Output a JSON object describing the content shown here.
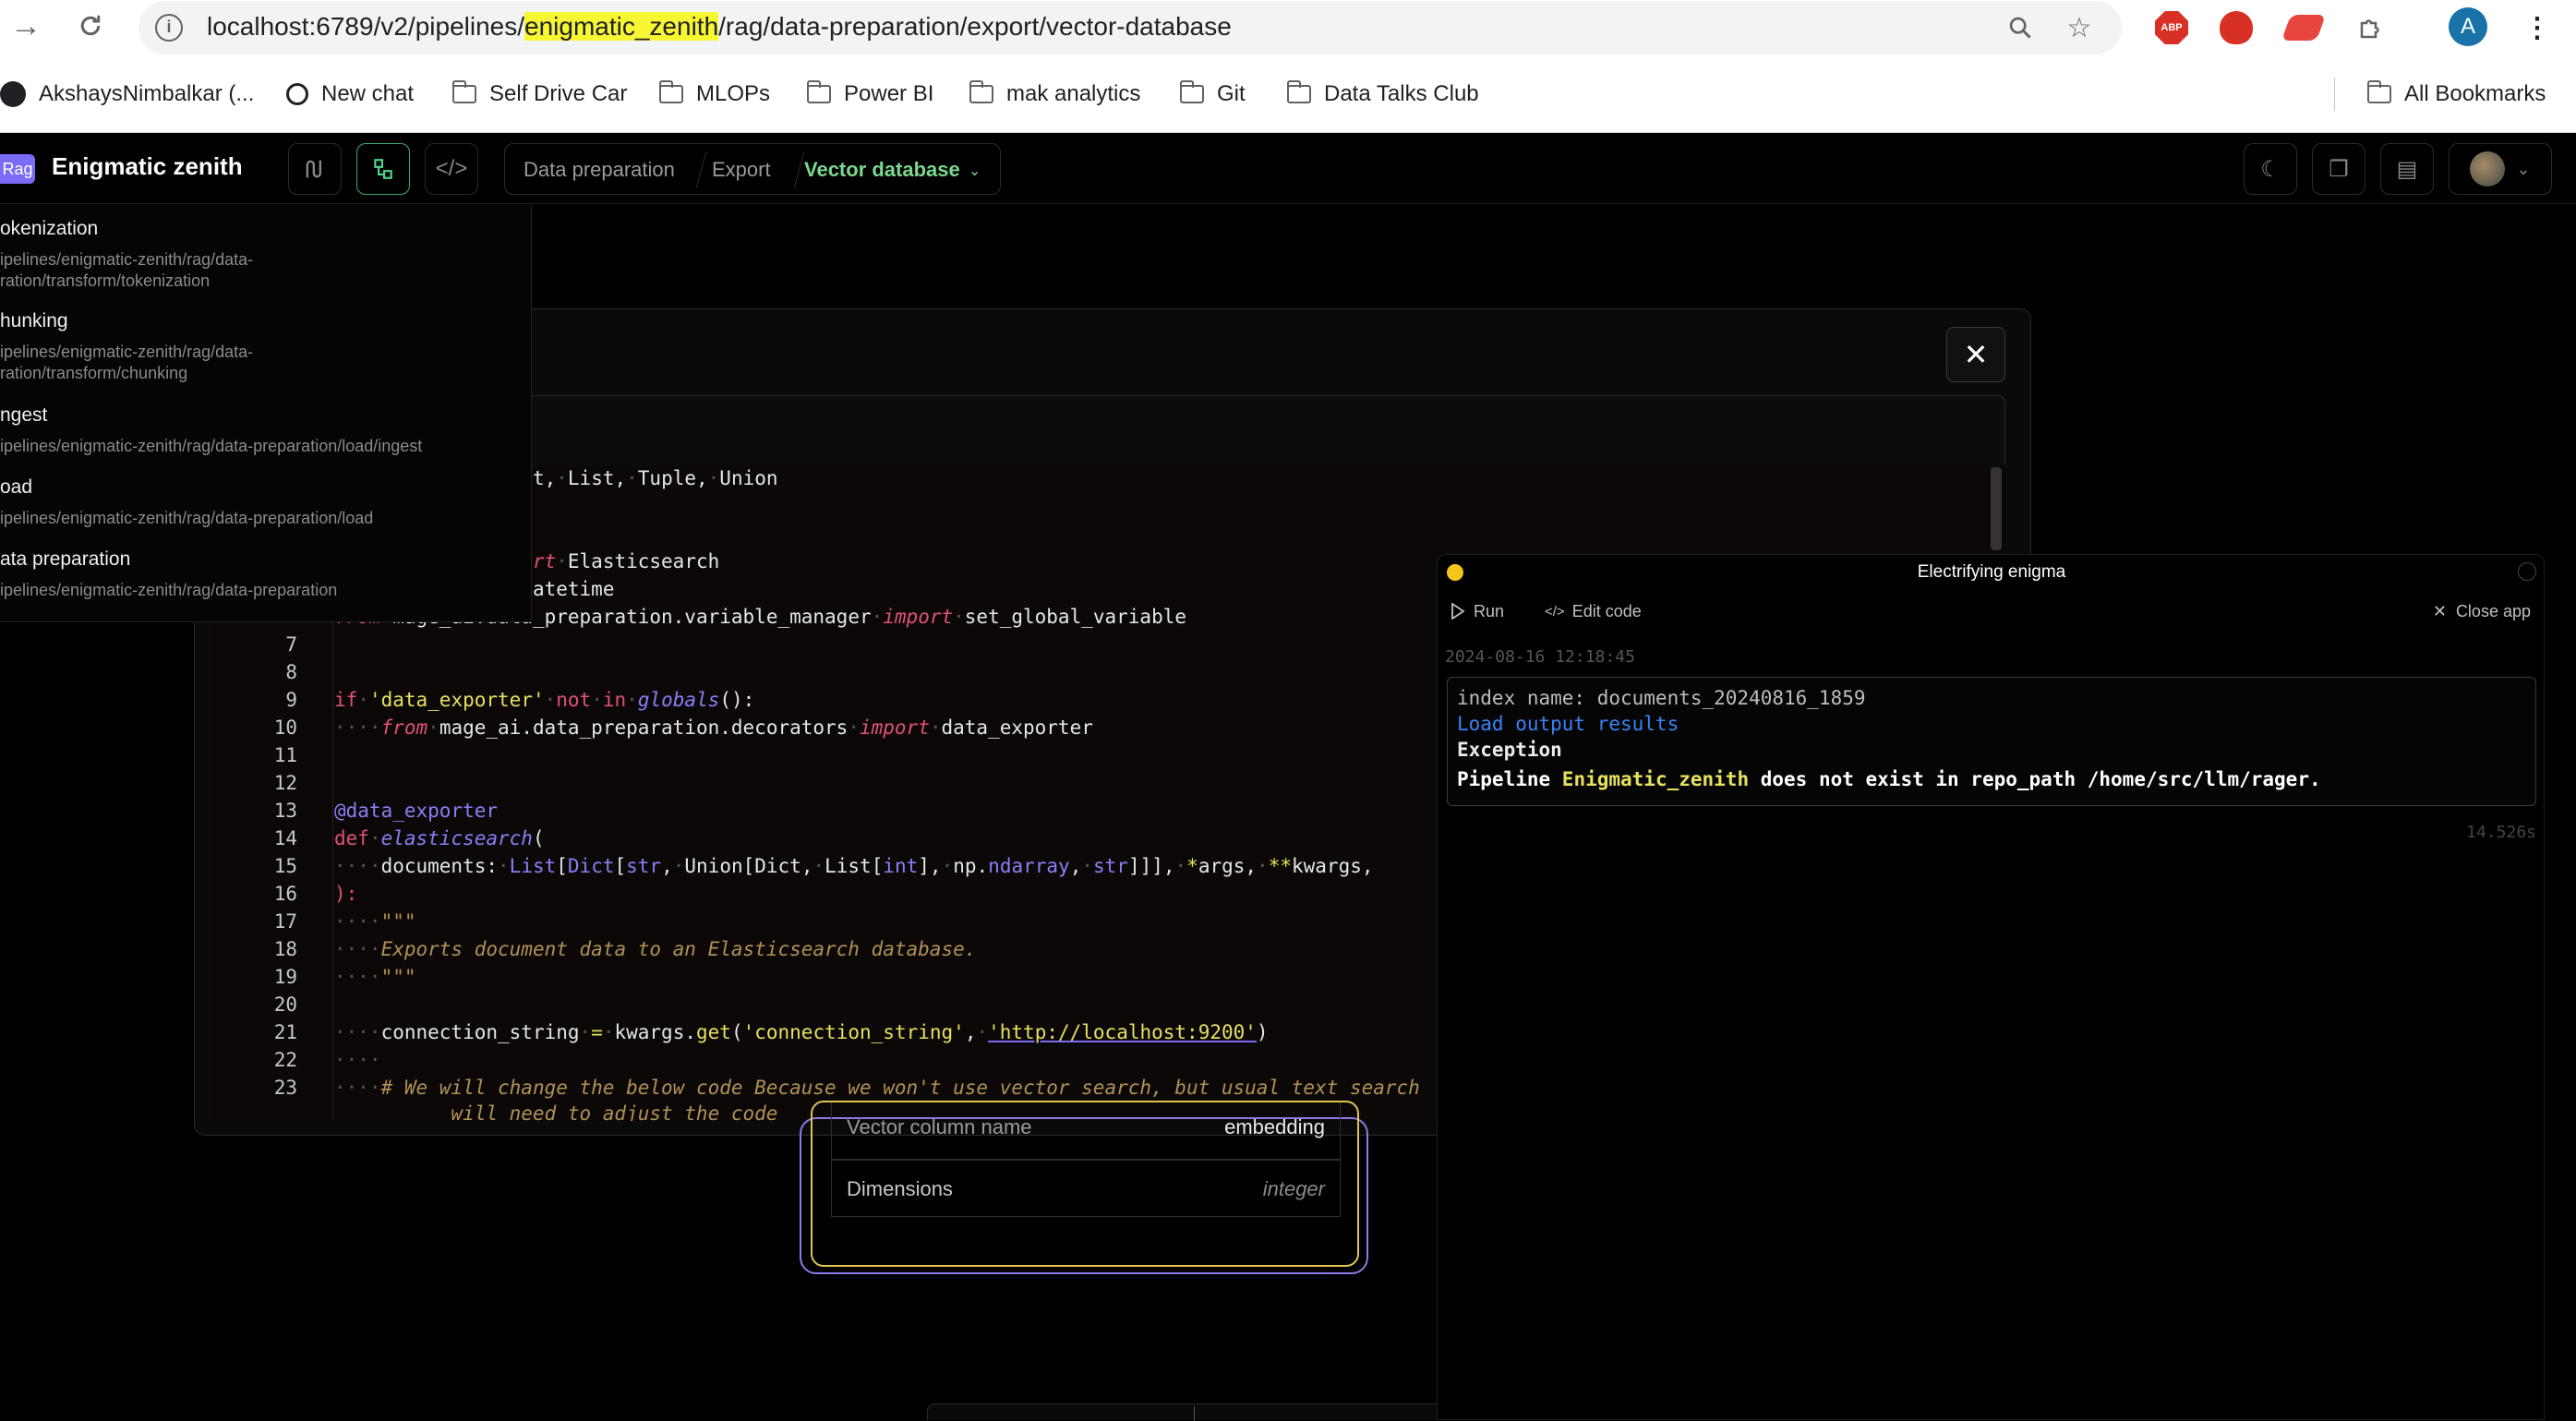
{
  "browser": {
    "url_prefix": "localhost:6789/v2/pipelines/",
    "url_highlight": "enigmatic_zenith",
    "url_suffix": "/rag/data-preparation/export/vector-database",
    "profile_initial": "A",
    "bookmarks": [
      "AkshaysNimbalkar (...",
      "New chat",
      "Self Drive Car",
      "MLOPs",
      "Power BI",
      "mak analytics",
      "Git",
      "Data Talks Club"
    ],
    "all_bookmarks": "All Bookmarks",
    "abp_label": "ABP"
  },
  "app": {
    "tag": "Rag",
    "title": "Enigmatic zenith",
    "breadcrumbs": [
      "Data preparation",
      "Export",
      "Vector database"
    ]
  },
  "dropdown": {
    "items": [
      {
        "title": "okenization",
        "path1": "ipelines/enigmatic-zenith/rag/data-",
        "path2": "ration/transform/tokenization"
      },
      {
        "title": "hunking",
        "path1": "ipelines/enigmatic-zenith/rag/data-",
        "path2": "ration/transform/chunking"
      },
      {
        "title": "ngest",
        "path1": "ipelines/enigmatic-zenith/rag/data-preparation/load/ingest",
        "path2": ""
      },
      {
        "title": "oad",
        "path1": "ipelines/enigmatic-zenith/rag/data-preparation/load",
        "path2": ""
      },
      {
        "title": "ata preparation",
        "path1": "ipelines/enigmatic-zenith/rag/data-preparation",
        "path2": ""
      }
    ]
  },
  "editor": {
    "line_numbers": [
      "7",
      "8",
      "9",
      "10",
      "11",
      "12",
      "13",
      "14",
      "15",
      "16",
      "17",
      "18",
      "19",
      "20",
      "21",
      "22",
      "23"
    ]
  },
  "output": {
    "title": "Electrifying enigma",
    "run_label": "Run",
    "edit_label": "Edit code",
    "close_label": "Close app",
    "timestamp": "2024-08-16 12:18:45",
    "index_line": "index name: documents_20240816_1859",
    "load_link": "Load output results",
    "exception_label": "Exception",
    "error_pre": "Pipeline ",
    "error_name": "Enigmatic_zenith",
    "error_post": " does not exist in repo_path /home/src/llm/rager.",
    "duration": "14.526s"
  },
  "config": {
    "rows": [
      {
        "label": "Vector column name",
        "value": "embedding"
      },
      {
        "label": "Dimensions",
        "value": "integer"
      }
    ]
  },
  "colors": {
    "accent_green": "#7bd88f",
    "tag_purple": "#7b6cf6",
    "warn_yellow": "#e0c44f"
  }
}
